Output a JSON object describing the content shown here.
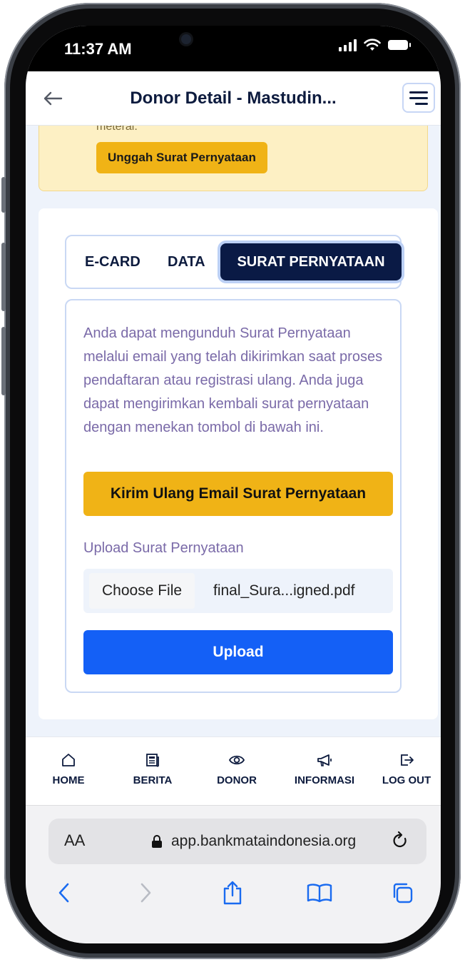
{
  "status_bar": {
    "time": "11:37 AM"
  },
  "header": {
    "title": "Donor Detail - Mastudin..."
  },
  "notice": {
    "text_fragment": "meterai.",
    "button_label": "Unggah Surat Pernyataan"
  },
  "tabs": [
    {
      "label": "E-CARD",
      "active": false
    },
    {
      "label": "DATA",
      "active": false
    },
    {
      "label": "SURAT PERNYATAAN",
      "active": true
    }
  ],
  "panel": {
    "description": "Anda dapat mengunduh Surat Pernyataan melalui email yang telah dikirimkan saat proses pendaftaran atau registrasi ulang. Anda juga dapat mengirimkan kembali surat pernyataan dengan menekan tombol di bawah ini.",
    "resend_button": "Kirim Ulang Email Surat Pernyataan",
    "upload_label": "Upload Surat Pernyataan",
    "choose_file_button": "Choose File",
    "file_name": "final_Sura...igned.pdf",
    "upload_button": "Upload"
  },
  "bottom_nav": [
    {
      "label": "HOME",
      "icon": "home-icon"
    },
    {
      "label": "BERITA",
      "icon": "newspaper-icon"
    },
    {
      "label": "DONOR",
      "icon": "eye-icon"
    },
    {
      "label": "INFORMASI",
      "icon": "megaphone-icon"
    },
    {
      "label": "LOG OUT",
      "icon": "logout-icon"
    }
  ],
  "browser": {
    "text_size_label": "AA",
    "url": "app.bankmataindonesia.org"
  },
  "colors": {
    "navy": "#0a1a45",
    "accent_yellow": "#f0b316",
    "primary_blue": "#1460f6",
    "muted_purple": "#7a6aa8",
    "notice_bg": "#fdf0c4"
  }
}
